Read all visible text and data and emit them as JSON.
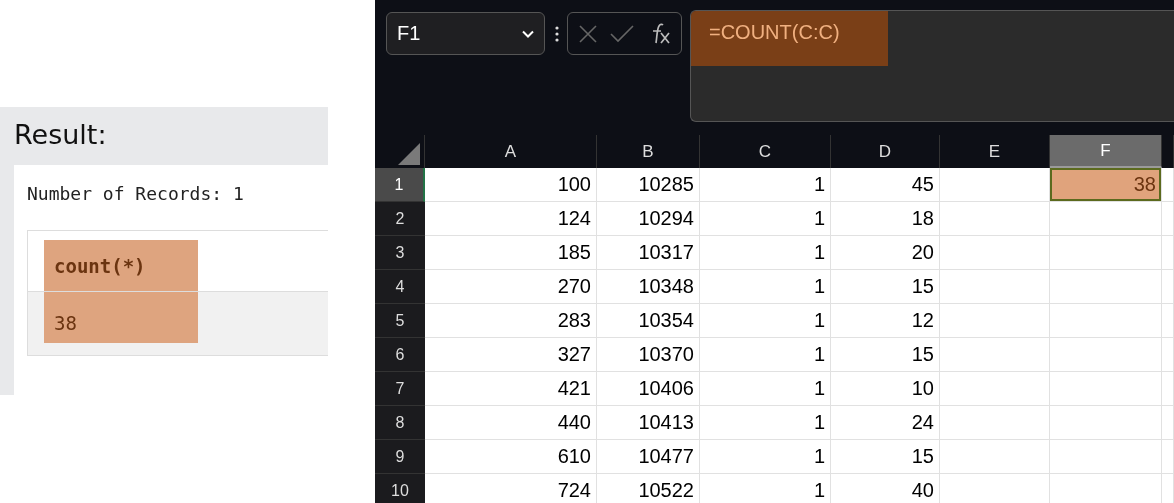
{
  "result_panel": {
    "title": "Result:",
    "record_count": "Number of Records: 1",
    "table": {
      "columns": [
        {
          "label": "count(*)",
          "highlighted": true
        }
      ],
      "rows": [
        [
          "38"
        ]
      ]
    }
  },
  "spreadsheet": {
    "name_box": "F1",
    "formula": {
      "text": "=COUNT(C:C)",
      "highlighted": true
    },
    "columns": [
      {
        "label": "A",
        "selected": false
      },
      {
        "label": "B",
        "selected": false
      },
      {
        "label": "C",
        "selected": false
      },
      {
        "label": "D",
        "selected": false
      },
      {
        "label": "E",
        "selected": false
      },
      {
        "label": "F",
        "selected": true
      }
    ],
    "rows": [
      {
        "number": "1",
        "selected": true,
        "values": [
          "100",
          "10285",
          "1",
          "45"
        ],
        "column_f": {
          "value": "38",
          "selected": true,
          "highlighted": true
        }
      },
      {
        "number": "2",
        "selected": false,
        "values": [
          "124",
          "10294",
          "1",
          "18"
        ]
      },
      {
        "number": "3",
        "selected": false,
        "values": [
          "185",
          "10317",
          "1",
          "20"
        ]
      },
      {
        "number": "4",
        "selected": false,
        "values": [
          "270",
          "10348",
          "1",
          "15"
        ]
      },
      {
        "number": "5",
        "selected": false,
        "values": [
          "283",
          "10354",
          "1",
          "12"
        ]
      },
      {
        "number": "6",
        "selected": false,
        "values": [
          "327",
          "10370",
          "1",
          "15"
        ]
      },
      {
        "number": "7",
        "selected": false,
        "values": [
          "421",
          "10406",
          "1",
          "10"
        ]
      },
      {
        "number": "8",
        "selected": false,
        "values": [
          "440",
          "10413",
          "1",
          "24"
        ]
      },
      {
        "number": "9",
        "selected": false,
        "values": [
          "610",
          "10477",
          "1",
          "15"
        ]
      },
      {
        "number": "10",
        "selected": false,
        "values": [
          "724",
          "10522",
          "1",
          "40"
        ]
      }
    ]
  }
}
